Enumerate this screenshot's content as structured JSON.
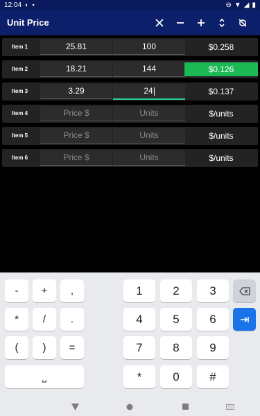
{
  "status": {
    "time": "12:04"
  },
  "app": {
    "title": "Unit Price"
  },
  "rows": [
    {
      "label": "Item 1",
      "price": "25.81",
      "units": "100",
      "ppu": "$0.258",
      "best": false
    },
    {
      "label": "Item 2",
      "price": "18.21",
      "units": "144",
      "ppu": "$0.126",
      "best": true
    },
    {
      "label": "Item 3",
      "price": "3.29",
      "units": "24",
      "ppu": "$0.137",
      "best": false
    },
    {
      "label": "Item 4",
      "price": "",
      "units": "",
      "ppu": "$/units",
      "best": false
    },
    {
      "label": "Item 5",
      "price": "",
      "units": "",
      "ppu": "$/units",
      "best": false
    },
    {
      "label": "Item 6",
      "price": "",
      "units": "",
      "ppu": "$/units",
      "best": false
    }
  ],
  "placeholders": {
    "price": "Price $",
    "units": "Units"
  },
  "colors": {
    "appbar": "#0c1f6a",
    "best": "#1db954",
    "focus_line": "#2bd492",
    "go_key": "#1a73e8"
  },
  "keyboard": {
    "sym": [
      "-",
      "+",
      ",",
      "*",
      "/",
      ".",
      "(",
      ")",
      "="
    ],
    "space": "⎵",
    "num": [
      "1",
      "2",
      "3",
      "4",
      "5",
      "6",
      "7",
      "8",
      "9",
      "*",
      "0",
      "#"
    ],
    "backspace_icon": "backspace-icon",
    "next_icon": "tab-next-icon"
  },
  "nav_icons": [
    "back-triangle-icon",
    "home-circle-icon",
    "recents-square-icon",
    "keyboard-switch-icon"
  ]
}
